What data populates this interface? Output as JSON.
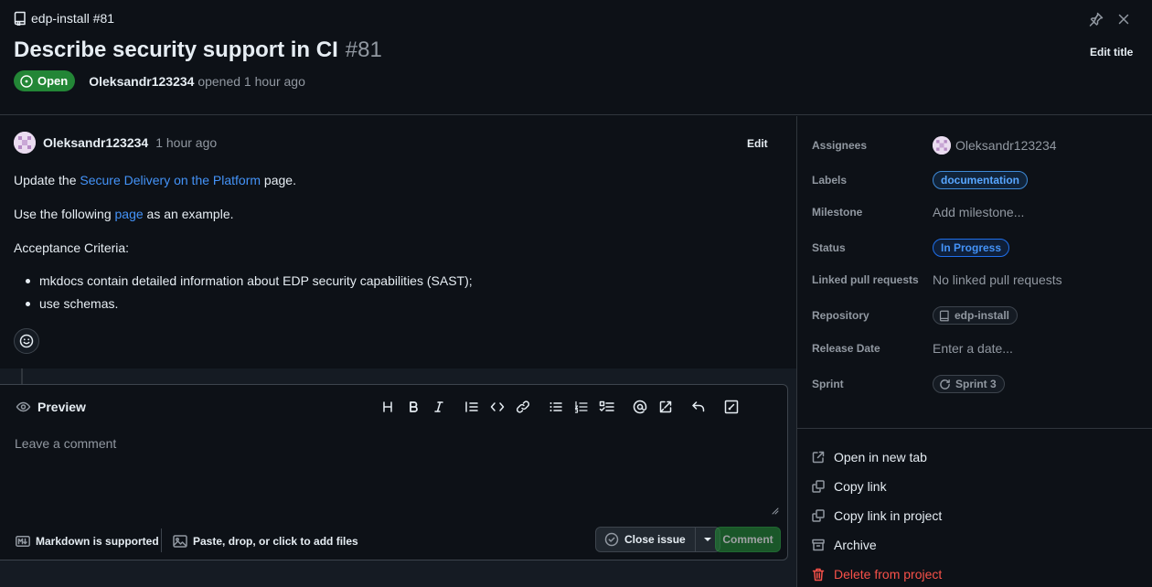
{
  "header": {
    "repo_ref": "edp-install #81",
    "title": "Describe security support in CI",
    "number": "#81",
    "state": "Open",
    "author": "Oleksandr123234",
    "opened_text": "opened 1 hour ago",
    "edit_title_label": "Edit title"
  },
  "comment": {
    "author": "Oleksandr123234",
    "time": "1 hour ago",
    "edit_label": "Edit",
    "line1_pre": "Update the ",
    "line1_link": "Secure Delivery on the Platform",
    "line1_post": " page.",
    "line2_pre": "Use the following ",
    "line2_link": "page",
    "line2_post": " as an example.",
    "line3": "Acceptance Criteria:",
    "bullets": [
      "mkdocs contain detailed information about EDP security capabilities (SAST);",
      "use schemas."
    ]
  },
  "composer": {
    "tab_label": "Preview",
    "placeholder": "Leave a comment",
    "markdown_label": "Markdown is supported",
    "attach_label": "Paste, drop, or click to add files",
    "close_issue_label": "Close issue",
    "comment_label": "Comment",
    "toolbar": [
      "heading",
      "bold",
      "italic",
      "quote",
      "code",
      "link",
      "bulleted-list",
      "numbered-list",
      "task-list",
      "mention",
      "reference",
      "undo",
      "fullscreen"
    ]
  },
  "sidebar": {
    "assignees_label": "Assignees",
    "assignee": "Oleksandr123234",
    "labels_label": "Labels",
    "label_value": "documentation",
    "milestone_label": "Milestone",
    "milestone_value": "Add milestone...",
    "status_label": "Status",
    "status_value": "In Progress",
    "linked_label": "Linked pull requests",
    "linked_value": "No linked pull requests",
    "repository_label": "Repository",
    "repository_value": "edp-install",
    "release_label": "Release Date",
    "release_value": "Enter a date...",
    "sprint_label": "Sprint",
    "sprint_value": "Sprint 3",
    "actions": {
      "open_tab": "Open in new tab",
      "copy_link": "Copy link",
      "copy_project": "Copy link in project",
      "archive": "Archive",
      "delete": "Delete from project"
    }
  },
  "colors": {
    "background": "#0d1117",
    "open_green": "#238636",
    "link_blue": "#4493f8",
    "danger_red": "#f85149"
  }
}
